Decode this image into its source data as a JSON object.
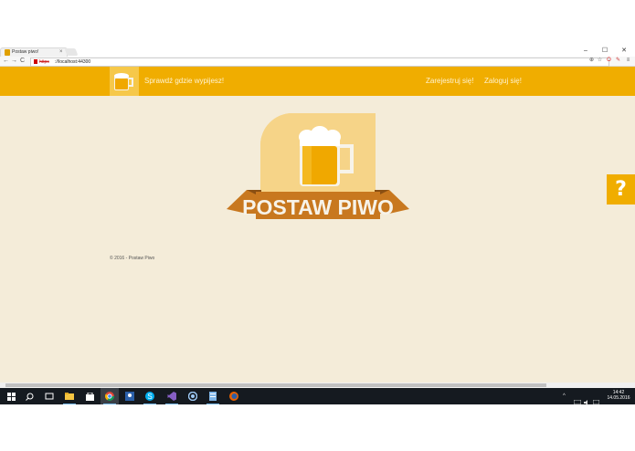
{
  "browser": {
    "tab_title": "Postaw piwo!",
    "tab_close": "×",
    "window_controls": [
      "–",
      "☐",
      "✕"
    ],
    "nav_buttons": [
      "←",
      "→",
      "C",
      "⌂"
    ],
    "url_scheme": "https",
    "url_host": "://localhost:44300",
    "toolbar_icons": [
      "zoom-icon",
      "star-icon",
      "opera-icon",
      "extension-icon",
      "menu-icon"
    ]
  },
  "navbar": {
    "brand": "Sprawdź gdzie wypijesz!",
    "register": "Zarejestruj się!",
    "login": "Zaloguj się!"
  },
  "hero": {
    "banner_text": "POSTAW PIWO"
  },
  "help_tab": {
    "label": "?"
  },
  "footer": {
    "copyright": "© 2016 - Postaw Piwo"
  },
  "taskbar": {
    "time": "14:42",
    "date": "14.05.2016",
    "tray_arrow": "^"
  },
  "colors": {
    "accent": "#f0ad00",
    "page_bg": "#f4ecd9",
    "banner": "#c8781f"
  }
}
